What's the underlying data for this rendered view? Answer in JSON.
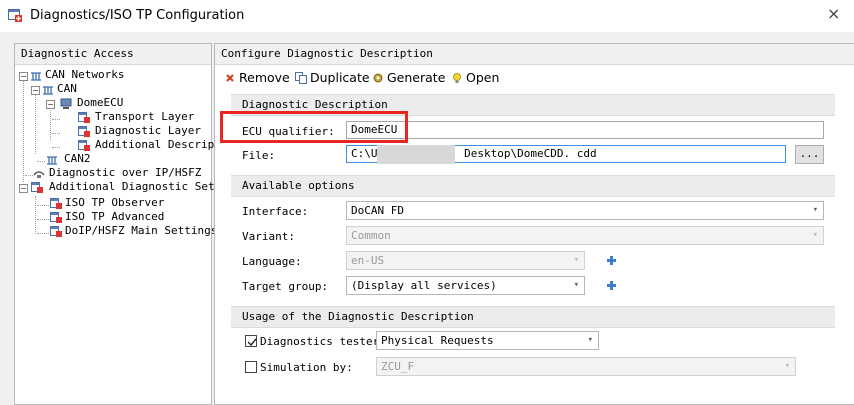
{
  "window": {
    "title": "Diagnostics/ISO TP Configuration",
    "close_glyph": "×",
    "title_icon": "app-config-icon"
  },
  "left_panel": {
    "header": "Diagnostic Access",
    "tree": {
      "can_networks": "CAN Networks",
      "can": "CAN",
      "domeecu": "DomeECU",
      "transport_layer": "Transport Layer",
      "diagnostic_layer": "Diagnostic Layer",
      "additional_descr": "Additional Descrip",
      "can2": "CAN2",
      "diag_over_ip": "Diagnostic over IP/HSFZ",
      "additional_diag_settings": "Additional Diagnostic Set",
      "iso_tp_observer": "ISO TP Observer",
      "iso_tp_advanced": "ISO TP Advanced",
      "doip_main": "DoIP/HSFZ Main Settings",
      "expand_minus": "−"
    }
  },
  "right_panel": {
    "header": "Configure Diagnostic Description",
    "toolbar": {
      "remove": "Remove",
      "duplicate": "Duplicate",
      "generate": "Generate",
      "open": "Open"
    },
    "sections": {
      "diag_desc": "Diagnostic Description",
      "available_options": "Available options",
      "usage": "Usage of the Diagnostic Description"
    },
    "ecu_qualifier": {
      "label": "ECU qualifier:",
      "value": "DomeECU"
    },
    "file": {
      "label": "File:",
      "value_prefix": "C:\\U:",
      "value_suffix": "Desktop\\DomeCDD. cdd",
      "browse": "..."
    },
    "interface": {
      "label": "Interface:",
      "value": "DoCAN FD"
    },
    "variant": {
      "label": "Variant:",
      "value": "Common"
    },
    "language": {
      "label": "Language:",
      "value": "en-US"
    },
    "target_group": {
      "label": "Target group:",
      "value": "(Display all services)"
    },
    "diagnostics_tester": {
      "label": "Diagnostics tester",
      "checked": true,
      "value": "Physical Requests"
    },
    "simulation_by": {
      "label": "Simulation by:",
      "checked": false,
      "value": "ZCU_F"
    }
  },
  "colors": {
    "highlight_box": "#e8261f",
    "focus_border": "#3a8ee6",
    "remove_icon": "#d23a1e"
  }
}
